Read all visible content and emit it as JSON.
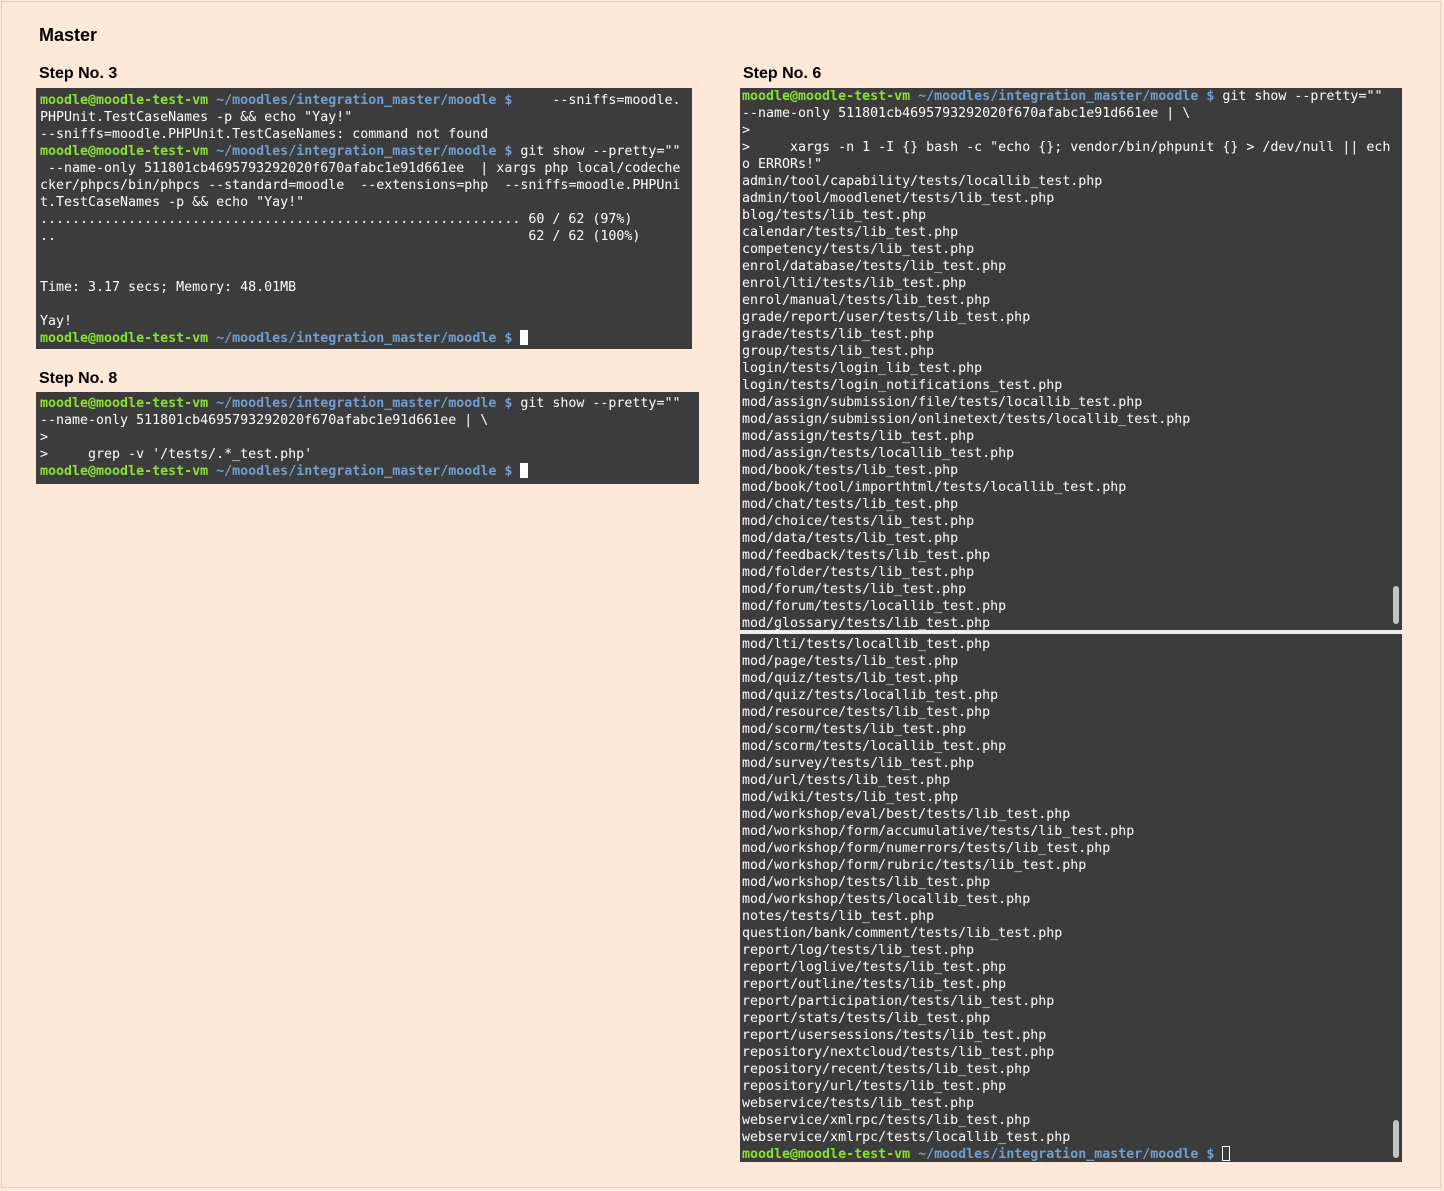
{
  "page_title": "Master",
  "steps": [
    {
      "label": "Step No. 3",
      "prompt_user": "moodle@moodle-test-vm",
      "prompt_path": "~/moodles/integration_master/moodle $",
      "lines": [
        {
          "type": "prompt",
          "text": "     --sniffs=moodle."
        },
        {
          "type": "text",
          "text": "PHPUnit.TestCaseNames -p && echo \"Yay!\""
        },
        {
          "type": "text",
          "text": "--sniffs=moodle.PHPUnit.TestCaseNames: command not found"
        },
        {
          "type": "prompt",
          "text": " git show --pretty=\"\""
        },
        {
          "type": "text",
          "text": " --name-only 511801cb4695793292020f670afabc1e91d661ee  | xargs php local/codeche"
        },
        {
          "type": "text",
          "text": "cker/phpcs/bin/phpcs --standard=moodle  --extensions=php  --sniffs=moodle.PHPUni"
        },
        {
          "type": "text",
          "text": "t.TestCaseNames -p && echo \"Yay!\""
        },
        {
          "type": "text",
          "text": "............................................................ 60 / 62 (97%)"
        },
        {
          "type": "text",
          "text": "..                                                           62 / 62 (100%)"
        },
        {
          "type": "text",
          "text": ""
        },
        {
          "type": "text",
          "text": ""
        },
        {
          "type": "text",
          "text": "Time: 3.17 secs; Memory: 48.01MB"
        },
        {
          "type": "text",
          "text": ""
        },
        {
          "type": "text",
          "text": "Yay!"
        },
        {
          "type": "prompt_cursor",
          "text": " "
        }
      ]
    },
    {
      "label": "Step No. 8",
      "prompt_user": "moodle@moodle-test-vm",
      "prompt_path": "~/moodles/integration_master/moodle $",
      "lines": [
        {
          "type": "prompt",
          "text": " git show --pretty=\"\""
        },
        {
          "type": "text",
          "text": "--name-only 511801cb4695793292020f670afabc1e91d661ee | \\"
        },
        {
          "type": "text",
          "text": ">"
        },
        {
          "type": "text",
          "text": ">     grep -v '/tests/.*_test.php'"
        },
        {
          "type": "prompt_cursor",
          "text": " "
        }
      ]
    },
    {
      "label": "Step No. 6",
      "prompt_user": "moodle@moodle-test-vm",
      "prompt_path": "~/moodles/integration_master/moodle $",
      "lines": [
        {
          "type": "prompt",
          "text": " git show --pretty=\"\""
        },
        {
          "type": "text",
          "text": "--name-only 511801cb4695793292020f670afabc1e91d661ee | \\"
        },
        {
          "type": "text",
          "text": ">"
        },
        {
          "type": "text",
          "text": ">     xargs -n 1 -I {} bash -c \"echo {}; vendor/bin/phpunit {} > /dev/null || ech"
        },
        {
          "type": "text",
          "text": "o ERRORs!\""
        },
        {
          "type": "text",
          "text": "admin/tool/capability/tests/locallib_test.php"
        },
        {
          "type": "text",
          "text": "admin/tool/moodlenet/tests/lib_test.php"
        },
        {
          "type": "text",
          "text": "blog/tests/lib_test.php"
        },
        {
          "type": "text",
          "text": "calendar/tests/lib_test.php"
        },
        {
          "type": "text",
          "text": "competency/tests/lib_test.php"
        },
        {
          "type": "text",
          "text": "enrol/database/tests/lib_test.php"
        },
        {
          "type": "text",
          "text": "enrol/lti/tests/lib_test.php"
        },
        {
          "type": "text",
          "text": "enrol/manual/tests/lib_test.php"
        },
        {
          "type": "text",
          "text": "grade/report/user/tests/lib_test.php"
        },
        {
          "type": "text",
          "text": "grade/tests/lib_test.php"
        },
        {
          "type": "text",
          "text": "group/tests/lib_test.php"
        },
        {
          "type": "text",
          "text": "login/tests/login_lib_test.php"
        },
        {
          "type": "text",
          "text": "login/tests/login_notifications_test.php"
        },
        {
          "type": "text",
          "text": "mod/assign/submission/file/tests/locallib_test.php"
        },
        {
          "type": "text",
          "text": "mod/assign/submission/onlinetext/tests/locallib_test.php"
        },
        {
          "type": "text",
          "text": "mod/assign/tests/lib_test.php"
        },
        {
          "type": "text",
          "text": "mod/assign/tests/locallib_test.php"
        },
        {
          "type": "text",
          "text": "mod/book/tests/lib_test.php"
        },
        {
          "type": "text",
          "text": "mod/book/tool/importhtml/tests/locallib_test.php"
        },
        {
          "type": "text",
          "text": "mod/chat/tests/lib_test.php"
        },
        {
          "type": "text",
          "text": "mod/choice/tests/lib_test.php"
        },
        {
          "type": "text",
          "text": "mod/data/tests/lib_test.php"
        },
        {
          "type": "text",
          "text": "mod/feedback/tests/lib_test.php"
        },
        {
          "type": "text",
          "text": "mod/folder/tests/lib_test.php"
        },
        {
          "type": "text",
          "text": "mod/forum/tests/lib_test.php"
        },
        {
          "type": "text",
          "text": "mod/forum/tests/locallib_test.php"
        },
        {
          "type": "text",
          "text": "mod/glossary/tests/lib_test.php"
        }
      ]
    },
    {
      "label": "",
      "prompt_user": "moodle@moodle-test-vm",
      "prompt_path": "~/moodles/integration_master/moodle $",
      "lines": [
        {
          "type": "text",
          "text": "mod/lti/tests/locallib_test.php"
        },
        {
          "type": "text",
          "text": "mod/page/tests/lib_test.php"
        },
        {
          "type": "text",
          "text": "mod/quiz/tests/lib_test.php"
        },
        {
          "type": "text",
          "text": "mod/quiz/tests/locallib_test.php"
        },
        {
          "type": "text",
          "text": "mod/resource/tests/lib_test.php"
        },
        {
          "type": "text",
          "text": "mod/scorm/tests/lib_test.php"
        },
        {
          "type": "text",
          "text": "mod/scorm/tests/locallib_test.php"
        },
        {
          "type": "text",
          "text": "mod/survey/tests/lib_test.php"
        },
        {
          "type": "text",
          "text": "mod/url/tests/lib_test.php"
        },
        {
          "type": "text",
          "text": "mod/wiki/tests/lib_test.php"
        },
        {
          "type": "text",
          "text": "mod/workshop/eval/best/tests/lib_test.php"
        },
        {
          "type": "text",
          "text": "mod/workshop/form/accumulative/tests/lib_test.php"
        },
        {
          "type": "text",
          "text": "mod/workshop/form/numerrors/tests/lib_test.php"
        },
        {
          "type": "text",
          "text": "mod/workshop/form/rubric/tests/lib_test.php"
        },
        {
          "type": "text",
          "text": "mod/workshop/tests/lib_test.php"
        },
        {
          "type": "text",
          "text": "mod/workshop/tests/locallib_test.php"
        },
        {
          "type": "text",
          "text": "notes/tests/lib_test.php"
        },
        {
          "type": "text",
          "text": "question/bank/comment/tests/lib_test.php"
        },
        {
          "type": "text",
          "text": "report/log/tests/lib_test.php"
        },
        {
          "type": "text",
          "text": "report/loglive/tests/lib_test.php"
        },
        {
          "type": "text",
          "text": "report/outline/tests/lib_test.php"
        },
        {
          "type": "text",
          "text": "report/participation/tests/lib_test.php"
        },
        {
          "type": "text",
          "text": "report/stats/tests/lib_test.php"
        },
        {
          "type": "text",
          "text": "report/usersessions/tests/lib_test.php"
        },
        {
          "type": "text",
          "text": "repository/nextcloud/tests/lib_test.php"
        },
        {
          "type": "text",
          "text": "repository/recent/tests/lib_test.php"
        },
        {
          "type": "text",
          "text": "repository/url/tests/lib_test.php"
        },
        {
          "type": "text",
          "text": "webservice/tests/lib_test.php"
        },
        {
          "type": "text",
          "text": "webservice/xmlrpc/tests/lib_test.php"
        },
        {
          "type": "text",
          "text": "webservice/xmlrpc/tests/locallib_test.php"
        },
        {
          "type": "prompt_cursor_hollow",
          "text": " "
        }
      ]
    }
  ],
  "colors": {
    "background": "#fde8da",
    "terminal_bg": "#3c3c3c",
    "prompt_user": "#8ae234",
    "prompt_path": "#729fcf",
    "text": "#ffffff"
  }
}
